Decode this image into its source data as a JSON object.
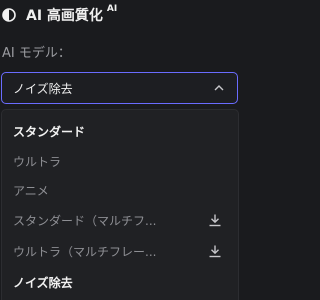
{
  "header": {
    "title": "AI 高画質化",
    "badge": "AI",
    "icon": "contrast-icon"
  },
  "model_field": {
    "label": "AI モデル：",
    "selected": "ノイズ除去"
  },
  "dropdown": {
    "options": [
      {
        "label": "スタンダード",
        "emphasis": true,
        "download": false
      },
      {
        "label": "ウルトラ",
        "emphasis": false,
        "download": false
      },
      {
        "label": "アニメ",
        "emphasis": false,
        "download": false
      },
      {
        "label": "スタンダード（マルチフ...",
        "emphasis": false,
        "download": true
      },
      {
        "label": "ウルトラ（マルチフレー...",
        "emphasis": false,
        "download": true
      },
      {
        "label": "ノイズ除去",
        "emphasis": true,
        "download": false
      }
    ]
  },
  "colors": {
    "background": "#1a1b1e",
    "accent_border": "#6a6cff",
    "menu_background": "#202124"
  }
}
